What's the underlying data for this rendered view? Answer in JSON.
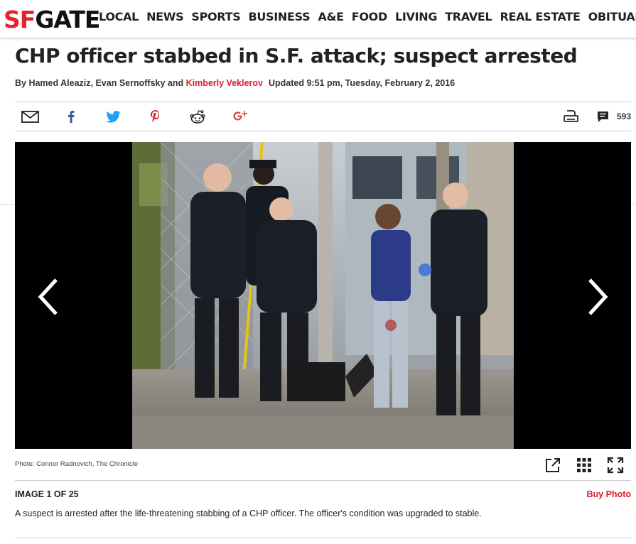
{
  "header": {
    "logo_sf": "SF",
    "logo_gate": "GATE",
    "nav": [
      "LOCAL",
      "NEWS",
      "SPORTS",
      "BUSINESS",
      "A&E",
      "FOOD",
      "LIVING",
      "TRAVEL",
      "REAL ESTATE",
      "OBITUARIES"
    ]
  },
  "article": {
    "headline": "CHP officer stabbed in S.F. attack; suspect arrested",
    "byline_prefix": "By Hamed Aleaziz, Evan Sernoffsky and ",
    "byline_link": "Kimberly Veklerov",
    "updated": "Updated 9:51 pm, Tuesday, February 2, 2016"
  },
  "share": {
    "icons": [
      "email-icon",
      "facebook-icon",
      "twitter-icon",
      "pinterest-icon",
      "reddit-icon",
      "google-plus-icon"
    ],
    "print_icon": "print-icon",
    "comment_icon": "comment-icon",
    "comment_count": "593"
  },
  "gallery": {
    "credit": "Photo: Connor Radnovich, The Chronicle",
    "image_count": "IMAGE 1 OF 25",
    "buy_photo": "Buy Photo",
    "caption": "A suspect is arrested after the life-threatening stabbing of a CHP officer. The officer's condition was upgraded to stable."
  },
  "colors": {
    "brand_red": "#e8212a",
    "link_red": "#d6202a",
    "facebook": "#3b5998",
    "twitter": "#1da1f2",
    "pinterest": "#cb2027",
    "google_plus": "#dd4b39"
  }
}
